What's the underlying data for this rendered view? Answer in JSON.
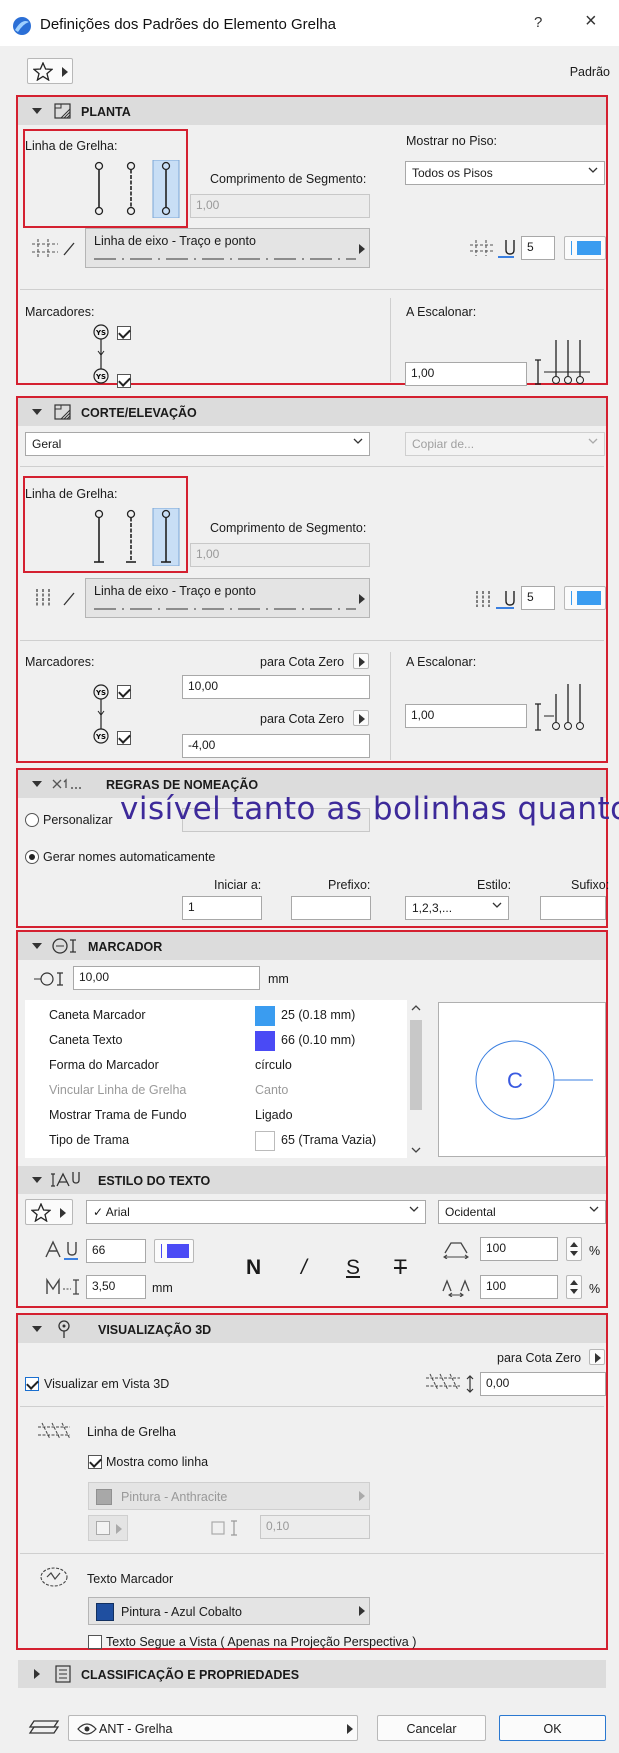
{
  "window": {
    "title": "Definições dos Padrões do Elemento Grelha",
    "help": "?",
    "close": "×"
  },
  "toolbar": {
    "preset": "Padrão"
  },
  "planta": {
    "title": "PLANTA",
    "grid_line_label": "Linha de Grelha:",
    "show_on_floor_label": "Mostrar no Piso:",
    "show_on_floor_value": "Todos os Pisos",
    "segment_length_label": "Comprimento de Segmento:",
    "segment_length_value": "1,00",
    "line_type": "Linha de eixo - Traço e ponto",
    "pen_value": "5",
    "markers_label": "Marcadores:",
    "scale_label": "A Escalonar:",
    "scale_value": "1,00"
  },
  "corte": {
    "title": "CORTE/ELEVAÇÃO",
    "mode_value": "Geral",
    "copy_placeholder": "Copiar de...",
    "grid_line_label": "Linha de Grelha:",
    "segment_length_label": "Comprimento de Segmento:",
    "segment_length_value": "1,00",
    "line_type": "Linha de eixo - Traço e ponto",
    "pen_value": "5",
    "markers_label": "Marcadores:",
    "zero_ref_1": "para Cota Zero",
    "zero_ref_1_value": "10,00",
    "zero_ref_2": "para Cota Zero",
    "zero_ref_2_value": "-4,00",
    "scale_label": "A Escalonar:",
    "scale_value": "1,00"
  },
  "naming": {
    "title": "REGRAS DE NOMEAÇÃO",
    "custom_label": "Personalizar",
    "overlay_text": "visível tanto as bolinhas quanto",
    "auto_label": "Gerar nomes automaticamente",
    "start_label": "Iniciar a:",
    "start_value": "1",
    "prefix_label": "Prefixo:",
    "prefix_value": "",
    "style_label": "Estilo:",
    "style_value": "1,2,3,...",
    "suffix_label": "Sufixo:",
    "suffix_value": ""
  },
  "marcador": {
    "title": "MARCADOR",
    "size_value": "10,00",
    "size_unit": "mm",
    "props": [
      {
        "name": "Caneta Marcador",
        "value": "25 (0.18 mm)",
        "swatch": "#3a9cf0",
        "disabled": false
      },
      {
        "name": "Caneta Texto",
        "value": "66 (0.10 mm)",
        "swatch": "#4a4af5",
        "disabled": false
      },
      {
        "name": "Forma do Marcador",
        "value": "círculo",
        "swatch": null,
        "disabled": false
      },
      {
        "name": "Vincular Linha de Grelha",
        "value": "Canto",
        "swatch": null,
        "disabled": true
      },
      {
        "name": "Mostrar Trama de Fundo",
        "value": "Ligado",
        "swatch": null,
        "disabled": false
      },
      {
        "name": "Tipo de Trama",
        "value": "65 (Trama Vazia)",
        "swatch": "#ffffff",
        "disabled": false
      }
    ],
    "preview_letter": "C"
  },
  "texto": {
    "title": "ESTILO DO TEXTO",
    "font": "Arial",
    "script": "Ocidental",
    "pen_value": "66",
    "size_value": "3,50",
    "size_unit": "mm",
    "bold": "N",
    "italic": "/",
    "underline": "S",
    "strike": "T",
    "width_value": "100",
    "spacing_value": "100",
    "percent": "%"
  },
  "vis3d": {
    "title": "VISUALIZAÇÃO 3D",
    "zero_ref": "para Cota Zero",
    "show_3d_label": "Visualizar em Vista 3D",
    "elevation_value": "0,00",
    "grid_line_label": "Linha de Grelha",
    "show_as_line_label": "Mostra como linha",
    "surface_value": "Pintura - Anthracite",
    "thickness_value": "0,10",
    "marker_text_label": "Texto Marcador",
    "marker_surface": "Pintura - Azul Cobalto",
    "follow_view_label": "Texto Segue a Vista ( Apenas na Projeção Perspectiva )"
  },
  "classif": {
    "title": "CLASSIFICAÇÃO E PROPRIEDADES"
  },
  "footer": {
    "layer": "ANT - Grelha",
    "cancel": "Cancelar",
    "ok": "OK"
  },
  "colors": {
    "accent_blue": "#3a9cf0",
    "red_outline": "#d42030",
    "pen_blue": "#4a4af5",
    "cobalt": "#1f4fa0"
  }
}
